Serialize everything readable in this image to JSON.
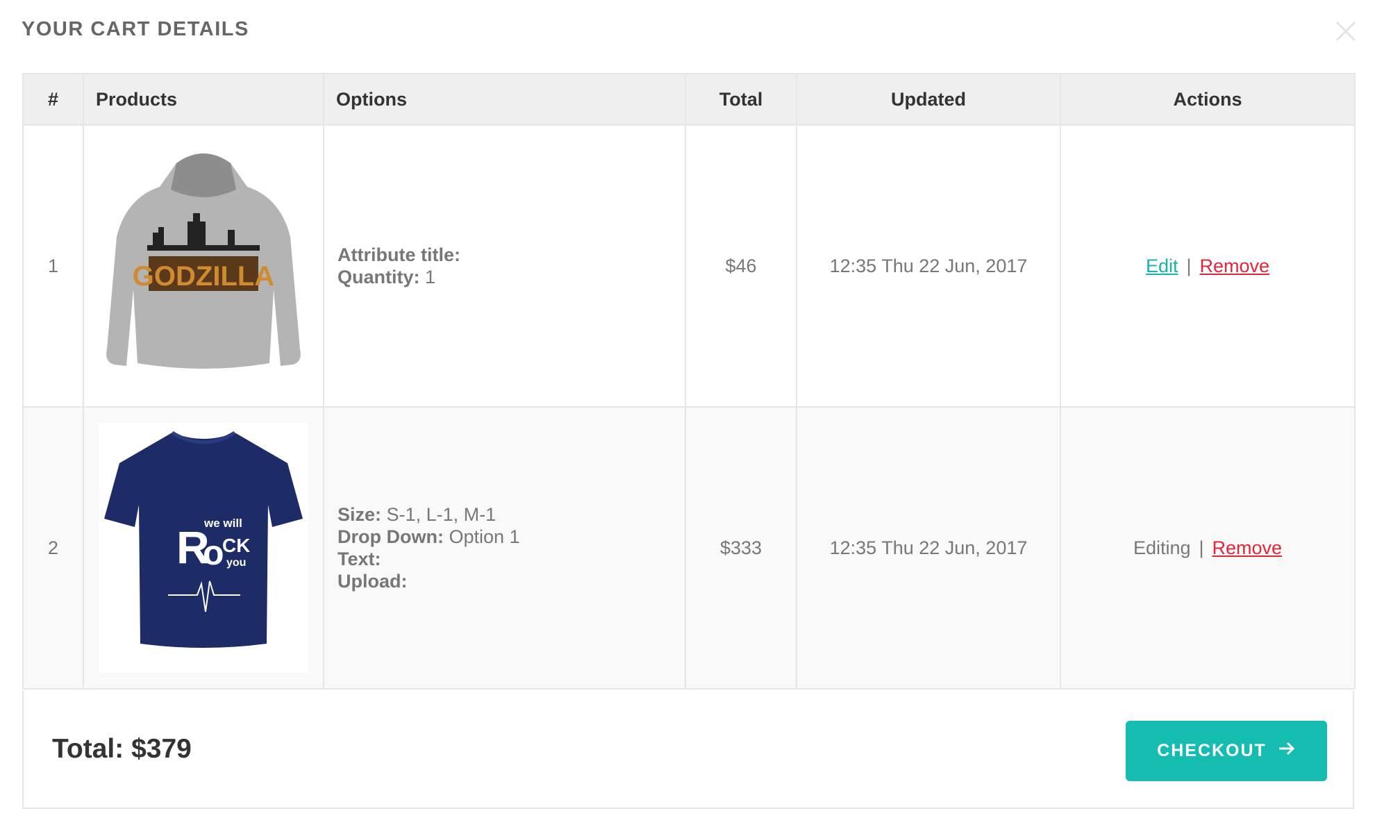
{
  "modal": {
    "title": "YOUR CART DETAILS"
  },
  "table": {
    "headers": [
      "#",
      "Products",
      "Options",
      "Total",
      "Updated",
      "Actions"
    ],
    "rows": [
      {
        "index": "1",
        "product_image": "Gray hoodie with GODZILLA print",
        "options": [
          {
            "label": "Attribute title:",
            "value": ""
          },
          {
            "label": "Quantity:",
            "value": "1"
          }
        ],
        "total": "$46",
        "updated": "12:35 Thu 22 Jun, 2017",
        "action_primary": "Edit",
        "separator": "|",
        "action_remove": "Remove"
      },
      {
        "index": "2",
        "product_image": "Navy t-shirt with We Will Rock You print",
        "options": [
          {
            "label": "Size:",
            "value": "S-1, L-1, M-1"
          },
          {
            "label": "Drop Down:",
            "value": "Option 1"
          },
          {
            "label": "Text:",
            "value": ""
          },
          {
            "label": "Upload:",
            "value": ""
          }
        ],
        "total": "$333",
        "updated": "12:35 Thu 22 Jun, 2017",
        "action_primary": "Editing",
        "separator": "|",
        "action_remove": "Remove"
      }
    ]
  },
  "footer": {
    "total_label": "Total: $379",
    "checkout_label": "CHECKOUT"
  },
  "icons": {
    "close": "close-icon",
    "checkout_arrow": "arrow-right-icon"
  },
  "colors": {
    "accent": "#14bdaf",
    "link_edit": "#12b5a7",
    "link_remove": "#e2263a",
    "header_bg": "#efefef"
  }
}
